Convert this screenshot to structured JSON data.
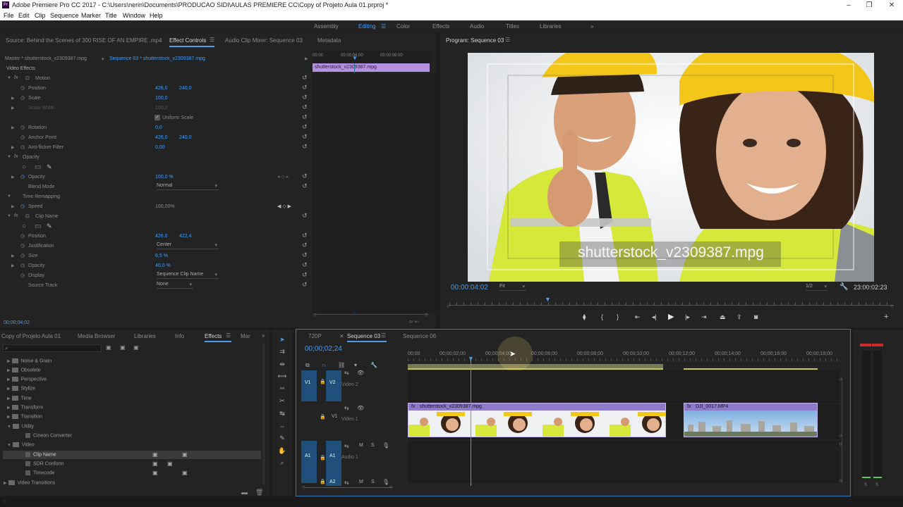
{
  "title": "Adobe Premiere Pro CC 2017 - C:\\Users\\nerin\\Documents\\PRODUCAO SIDI\\AULAS PREMIERE CC\\Copy of Projeto Aula 01.prproj *",
  "menu": [
    "File",
    "Edit",
    "Clip",
    "Sequence",
    "Marker",
    "Title",
    "Window",
    "Help"
  ],
  "workspaces": [
    "Assembly",
    "Editing",
    "Color",
    "Effects",
    "Audio",
    "Titles",
    "Libraries"
  ],
  "more": "»",
  "ec": {
    "tabs": {
      "source": "Source: Behind the Scenes of 300 RISE OF AN EMPIRE .mp4",
      "effect": "Effect Controls",
      "mixer": "Audio Clip Mixer: Sequence 03",
      "meta": "Metadata"
    },
    "master": "Master * shutterstock_v2309387.mpg",
    "sequence": "Sequence 03 * shutterstock_v2309387.mpg",
    "ruler": [
      "00:00",
      "00;00;04;00",
      "00;00;08;00"
    ],
    "clip": "shutterstock_v2309387.mpg",
    "video_effects": "Video Effects",
    "motion": "Motion",
    "position": "Position",
    "pos_x": "426,0",
    "pos_y": "240,0",
    "scale": "Scale",
    "scale_v": "100,0",
    "scale_w": "Scale Width",
    "scale_w_v": "100,0",
    "uniform": "Uniform Scale",
    "rotation": "Rotation",
    "rotation_v": "0,0",
    "anchor": "Anchor Point",
    "anchor_x": "426,0",
    "anchor_y": "240,0",
    "flicker": "Anti-flicker Filter",
    "flicker_v": "0,00",
    "opacity_h": "Opacity",
    "opacity": "Opacity",
    "opacity_v": "100,0 %",
    "blend": "Blend Mode",
    "blend_v": "Normal",
    "remap": "Time Remapping",
    "speed": "Speed",
    "speed_v": "100,00%",
    "clipname": "Clip Name",
    "cn_pos": "Position",
    "cn_pos_x": "426,0",
    "cn_pos_y": "422,4",
    "just": "Justification",
    "just_v": "Center",
    "size": "Size",
    "size_v": "6,5 %",
    "cn_opacity": "Opacity",
    "cn_opacity_v": "40,0 %",
    "display": "Display",
    "display_v": "Sequence Clip Name",
    "source_track": "Source Track",
    "source_track_v": "None",
    "timecode": "00;00;04;02"
  },
  "program": {
    "tab": "Program: Sequence 03",
    "overlay": "shutterstock_v2309387.mpg",
    "timecode": "00:00:04:02",
    "fit": "Fit",
    "res": "1/2",
    "duration": "23:00:02:23"
  },
  "project": {
    "tabs": {
      "project": "Copy of Projeto Aula 01",
      "browser": "Media Browser",
      "libraries": "Libraries",
      "info": "Info",
      "effects": "Effects",
      "markers": "Mar"
    },
    "search": "",
    "items": [
      "Noise & Grain",
      "Obsolete",
      "Perspective",
      "Stylize",
      "Time",
      "Transform",
      "Transition",
      "Utility",
      "Cineon Converter",
      "Video",
      "Clip Name",
      "SDR Conform",
      "Timecode",
      "Video Transitions"
    ]
  },
  "timeline": {
    "tabs": {
      "t1": "720P",
      "t2": "Sequence 03",
      "t3": "Sequence 06"
    },
    "timecode": "00;00;02;24",
    "ruler": [
      "00;00",
      "00;00;02;00",
      "00;00;04;00",
      "00;00;06;00",
      "00;00;08;00",
      "00;00;10;00",
      "00;00;12;00",
      "00;00;14;00",
      "00;00;16;00",
      "00;00;18;00"
    ],
    "v2": "V2",
    "v2name": "Video 2",
    "v1": "V1",
    "v1name": "Video 1",
    "a1": "A1",
    "a1name": "Audio 1",
    "a2": "A2",
    "clip1": "shutterstock_v2309387.mpg",
    "clip2": "DJI_0017.MP4",
    "m": "M",
    "s": "S",
    "meter_labels": [
      "S",
      "S"
    ]
  },
  "colors": {
    "accent": "#4a9cf0",
    "clip_pink": "#b58fe0",
    "clip_video": "#8f79c9",
    "track": "#1f4f7a"
  }
}
